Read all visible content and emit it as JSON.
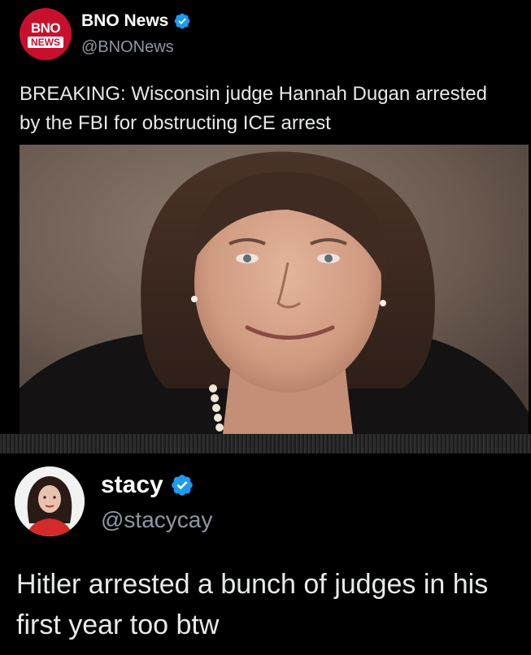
{
  "tweets": [
    {
      "avatar": {
        "logo_top": "BNO",
        "logo_bottom": "NEWS",
        "color": "#c8102e"
      },
      "author": {
        "name": "BNO News",
        "handle": "@BNONews",
        "verified": true
      },
      "text": "BREAKING: Wisconsin judge Hannah Dugan arrested by the FBI for obstructing ICE arrest"
    },
    {
      "author": {
        "name": "stacy",
        "handle": "@stacycay",
        "verified": true
      },
      "text": "Hitler arrested a bunch of judges in his first year too btw"
    }
  ],
  "colors": {
    "background": "#000000",
    "text": "#e7e9ea",
    "secondary_text": "#8b98a5",
    "verified_badge": "#1d9bf0"
  }
}
